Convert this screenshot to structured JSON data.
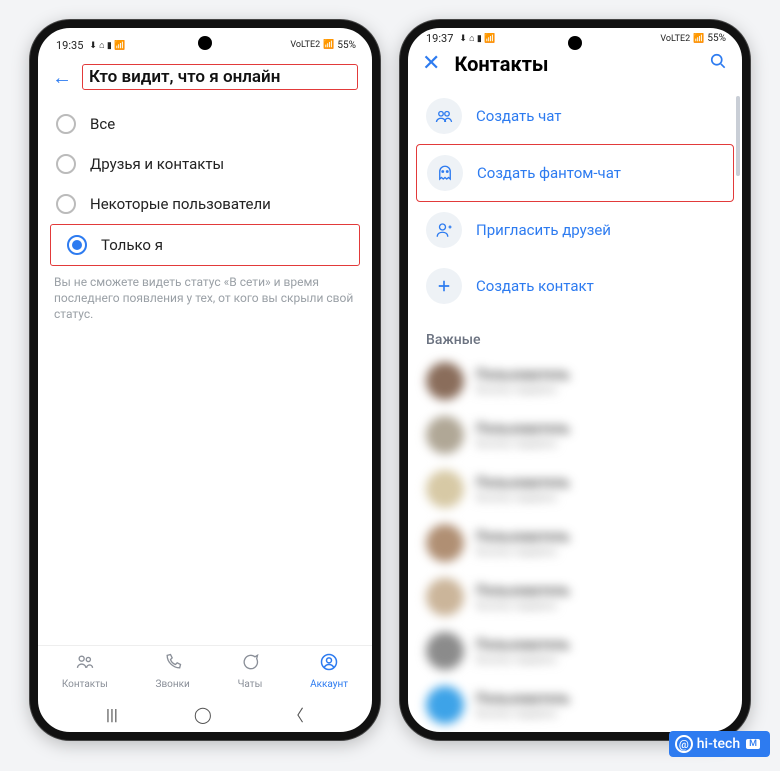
{
  "statusbar": {
    "time_left": "19:35",
    "time_right": "19:37",
    "indicators": "⬇ ⌂ ▮ 📶",
    "net": "VoLTE2",
    "wifi": "📶",
    "batt": "55%"
  },
  "screen1": {
    "title": "Кто видит, что я онлайн",
    "options": [
      {
        "label": "Все",
        "selected": false
      },
      {
        "label": "Друзья и контакты",
        "selected": false
      },
      {
        "label": "Некоторые пользователи",
        "selected": false
      },
      {
        "label": "Только я",
        "selected": true
      }
    ],
    "helper": "Вы не сможете видеть статус «В сети» и время последнего появления у тех, от кого вы скрыли свой статус.",
    "bottom_nav": [
      {
        "label": "Контакты"
      },
      {
        "label": "Звонки"
      },
      {
        "label": "Чаты"
      },
      {
        "label": "Аккаунт"
      }
    ]
  },
  "screen2": {
    "title": "Контакты",
    "actions": [
      {
        "label": "Создать чат",
        "icon": "group",
        "hl": false
      },
      {
        "label": "Создать фантом-чат",
        "icon": "ghost",
        "hl": true
      },
      {
        "label": "Пригласить друзей",
        "icon": "adduser",
        "hl": false
      },
      {
        "label": "Создать контакт",
        "icon": "plus",
        "hl": false
      }
    ],
    "section": "Важные",
    "contacts": [
      {
        "name": "Пользователь",
        "sub": "был(а) недавно",
        "color": "#8a6d5b"
      },
      {
        "name": "Пользователь",
        "sub": "был(а) недавно",
        "color": "#b0a796"
      },
      {
        "name": "Пользователь",
        "sub": "был(а) недавно",
        "color": "#d7c9a5"
      },
      {
        "name": "Пользователь",
        "sub": "был(а) недавно",
        "color": "#b08f73"
      },
      {
        "name": "Пользователь",
        "sub": "был(а) недавно",
        "color": "#cbb59a"
      },
      {
        "name": "Пользователь",
        "sub": "был(а) недавно",
        "color": "#8b8b8b"
      },
      {
        "name": "Пользователь",
        "sub": "был(а) недавно",
        "color": "#3da3e8"
      }
    ]
  },
  "watermark": {
    "at": "@",
    "text": "hi-tech",
    "tag": "M"
  }
}
